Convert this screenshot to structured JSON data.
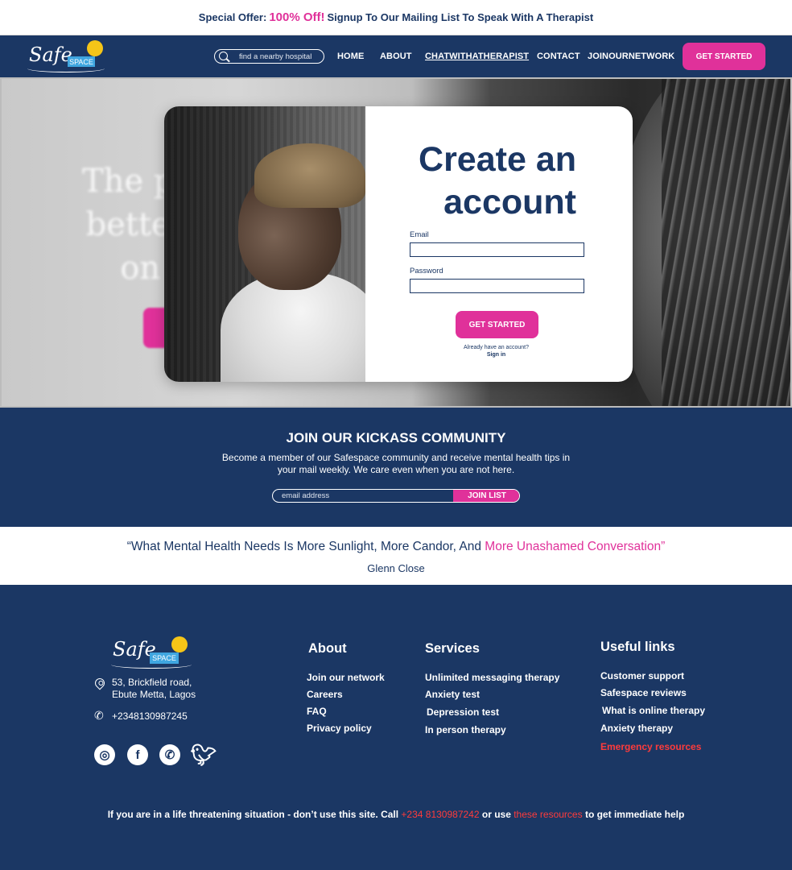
{
  "offer": {
    "prefix": "Special Offer:",
    "highlight": "100% Off!",
    "suffix": "Signup To Our Mailing List To Speak With A Therapist"
  },
  "brand": {
    "script": "Safe",
    "box": "SPACE",
    "colors": {
      "navy": "#1b3764",
      "pink": "#e0319a",
      "sky": "#3fa6e0",
      "sun": "#f5c518",
      "alert": "#ff3b3b"
    }
  },
  "nav": {
    "search_placeholder": "find a nearby hospital",
    "links": [
      "HOME",
      "ABOUT",
      "CHATWITHATHERAPIST",
      "CONTACT",
      "JOINOURNETWORK"
    ],
    "cta": "GET STARTED"
  },
  "hero": {
    "bg_lines": [
      "The p",
      "bette",
      "on"
    ]
  },
  "signup": {
    "title_line1": "Create an",
    "title_line2": "account",
    "email_label": "Email",
    "password_label": "Password",
    "submit": "GET STARTED",
    "already": "Already have an account?",
    "signin": "Sign in"
  },
  "community": {
    "heading": "JOIN OUR KICKASS COMMUNITY",
    "text": "Become a member of our Safespace community and receive mental health tips in your mail weekly. We care even when you are not here.",
    "email_placeholder": "email address",
    "button": "JOIN LIST"
  },
  "quote": {
    "open": "“What Mental Health Needs Is More Sunlight, More Candor, And ",
    "highlight": "More Unashamed Conversation”",
    "author": "Glenn Close"
  },
  "footer": {
    "address_line1": "53, Brickfield road,",
    "address_line2": "Ebute Metta, Lagos",
    "phone": "+2348130987245",
    "social": [
      "instagram-icon",
      "facebook-icon",
      "whatsapp-icon",
      "twitter-icon"
    ],
    "about": {
      "heading": "About",
      "links": [
        "Join our network",
        "Careers",
        "FAQ",
        "Privacy policy"
      ]
    },
    "services": {
      "heading": "Services",
      "links": [
        "Unlimited messaging therapy",
        "Anxiety test",
        "Depression test",
        "In person therapy"
      ]
    },
    "useful": {
      "heading": "Useful links",
      "links": [
        "Customer support",
        "Safespace reviews",
        "What is online therapy",
        "Anxiety therapy",
        "Emergency resources"
      ]
    },
    "disclaimer": {
      "part1": "If you are in a life threatening situation - don’t use this site. Call ",
      "phone": "+234 8130987242",
      "part2": " or use ",
      "link": "these resources",
      "part3": " to get immediate help"
    }
  }
}
